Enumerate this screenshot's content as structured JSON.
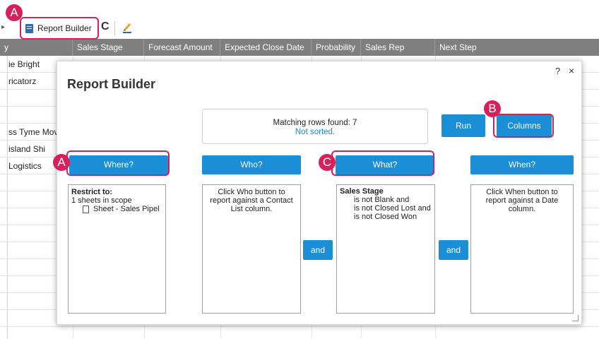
{
  "toolbar": {
    "report_builder_label": "Report Builder",
    "refresh_symbol": "C"
  },
  "grid": {
    "columns": [
      "y",
      "Sales Stage",
      "Forecast Amount",
      "Expected Close Date",
      "Probability",
      "Sales Rep",
      "Next Step"
    ],
    "first_column_values": [
      "ie Bright",
      "ricatorz",
      "",
      "",
      "ss Tyme Mov",
      "island Shi",
      "Logistics",
      "",
      "",
      "",
      "",
      "",
      "",
      "",
      "",
      ""
    ]
  },
  "modal": {
    "title": "Report Builder",
    "help": "?",
    "close": "×",
    "status_main": "Matching rows found: 7",
    "status_sub": "Not sorted.",
    "run_label": "Run",
    "columns_label": "Columns",
    "where_label": "Where?",
    "who_label": "Who?",
    "what_label": "What?",
    "when_label": "When?",
    "and_label": "and",
    "where_panel": {
      "heading": "Restrict to:",
      "scope": "1 sheets in scope",
      "sheet": "Sheet - Sales Pipel"
    },
    "who_panel_text": "Click Who button to report against a Contact List column.",
    "what_panel": {
      "heading": "Sales Stage",
      "lines": [
        "is not Blank and",
        "is not Closed Lost and",
        "is not Closed Won"
      ]
    },
    "when_panel_text": "Click When button to report against a Date column."
  },
  "callouts": {
    "a_top": "A",
    "a_where": "A",
    "b_columns": "B",
    "c_what": "C"
  },
  "colors": {
    "accent_blue": "#1a8fd8",
    "highlight": "#d61f5b",
    "header_gray": "#7f7f7f"
  }
}
